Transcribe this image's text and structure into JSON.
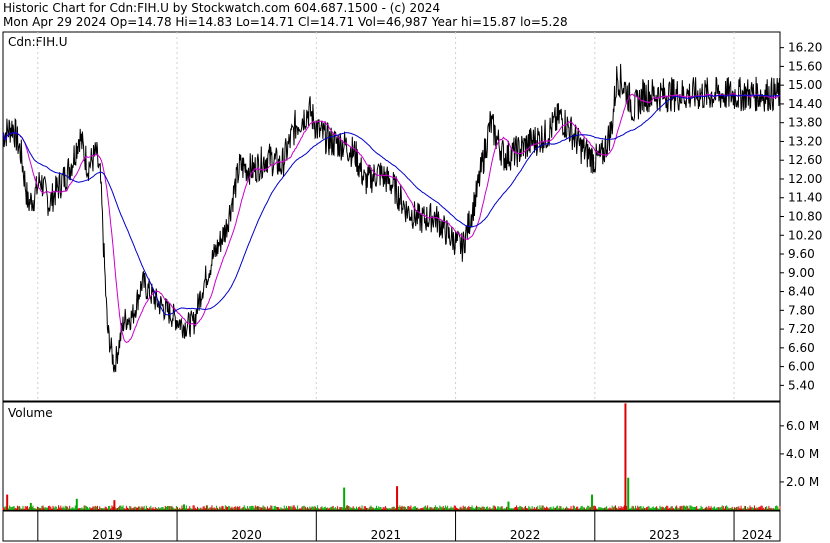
{
  "header": {
    "line1": "Historic Chart for Cdn:FIH.U by Stockwatch.com 604.687.1500 - (c) 2024",
    "line2": "Mon Apr 29 2024   Op=14.78   Hi=14.83   Lo=14.71   Cl=14.71   Vol=46,987   Year hi=15.87   lo=5.28"
  },
  "chart_data": [
    {
      "type": "line",
      "title": "Cdn:FIH.U",
      "ylim": [
        4.9,
        16.7
      ],
      "y_ticks": [
        "16.20",
        "15.60",
        "15.00",
        "14.40",
        "13.80",
        "13.20",
        "12.60",
        "12.00",
        "11.40",
        "10.80",
        "10.20",
        "9.60",
        "9.00",
        "8.40",
        "7.80",
        "7.20",
        "6.60",
        "6.00",
        "5.40"
      ],
      "x_labels": [
        "2019",
        "2020",
        "2021",
        "2022",
        "2023",
        "2024"
      ],
      "x_domain": [
        2018.75,
        2024.33
      ],
      "anchors": [
        [
          2018.75,
          13.4
        ],
        [
          2018.82,
          13.7
        ],
        [
          2018.88,
          12.8
        ],
        [
          2018.93,
          11.2
        ],
        [
          2018.97,
          11.4
        ],
        [
          2019.02,
          12.0
        ],
        [
          2019.08,
          11.2
        ],
        [
          2019.14,
          11.7
        ],
        [
          2019.2,
          12.1
        ],
        [
          2019.25,
          12.6
        ],
        [
          2019.3,
          13.4
        ],
        [
          2019.36,
          12.4
        ],
        [
          2019.42,
          12.8
        ],
        [
          2019.45,
          12.0
        ],
        [
          2019.5,
          7.2
        ],
        [
          2019.55,
          6.0
        ],
        [
          2019.62,
          7.5
        ],
        [
          2019.68,
          7.6
        ],
        [
          2019.75,
          8.7
        ],
        [
          2019.85,
          8.1
        ],
        [
          2019.95,
          7.7
        ],
        [
          2020.05,
          7.3
        ],
        [
          2020.12,
          7.4
        ],
        [
          2020.18,
          8.5
        ],
        [
          2020.25,
          9.4
        ],
        [
          2020.35,
          10.4
        ],
        [
          2020.45,
          12.4
        ],
        [
          2020.55,
          12.3
        ],
        [
          2020.65,
          12.7
        ],
        [
          2020.75,
          12.4
        ],
        [
          2020.85,
          13.7
        ],
        [
          2020.95,
          14.2
        ],
        [
          2021.02,
          13.5
        ],
        [
          2021.1,
          13.2
        ],
        [
          2021.2,
          13.1
        ],
        [
          2021.28,
          12.8
        ],
        [
          2021.35,
          11.9
        ],
        [
          2021.45,
          12.2
        ],
        [
          2021.55,
          11.8
        ],
        [
          2021.65,
          11.0
        ],
        [
          2021.75,
          10.7
        ],
        [
          2021.85,
          10.8
        ],
        [
          2021.95,
          10.2
        ],
        [
          2022.05,
          9.8
        ],
        [
          2022.15,
          11.5
        ],
        [
          2022.25,
          13.8
        ],
        [
          2022.35,
          12.7
        ],
        [
          2022.45,
          12.9
        ],
        [
          2022.55,
          13.2
        ],
        [
          2022.65,
          13.4
        ],
        [
          2022.75,
          14.0
        ],
        [
          2022.82,
          13.6
        ],
        [
          2022.9,
          13.0
        ],
        [
          2023.0,
          12.6
        ],
        [
          2023.05,
          12.7
        ],
        [
          2023.12,
          13.6
        ],
        [
          2023.16,
          15.3
        ],
        [
          2023.22,
          14.9
        ],
        [
          2023.28,
          14.2
        ],
        [
          2023.35,
          14.7
        ],
        [
          2024.33,
          14.71
        ]
      ]
    },
    {
      "type": "bar",
      "title": "Volume",
      "ylim": [
        0,
        7700000
      ],
      "y_ticks": [
        "6.0 M",
        "4.0 M",
        "2.0 M"
      ],
      "spikes": [
        [
          2018.78,
          1100000
        ],
        [
          2018.95,
          500000
        ],
        [
          2019.28,
          800000
        ],
        [
          2019.55,
          700000
        ],
        [
          2020.05,
          400000
        ],
        [
          2021.2,
          1600000
        ],
        [
          2021.58,
          1700000
        ],
        [
          2022.38,
          600000
        ],
        [
          2022.98,
          1100000
        ],
        [
          2023.22,
          7600000
        ],
        [
          2023.24,
          2300000
        ]
      ]
    }
  ],
  "colors": {
    "price": "#000000",
    "ma_fast": "#cc00cc",
    "ma_slow": "#0000cc",
    "vol_up": "#00aa00",
    "vol_down": "#dd0000",
    "frame": "#000000"
  }
}
